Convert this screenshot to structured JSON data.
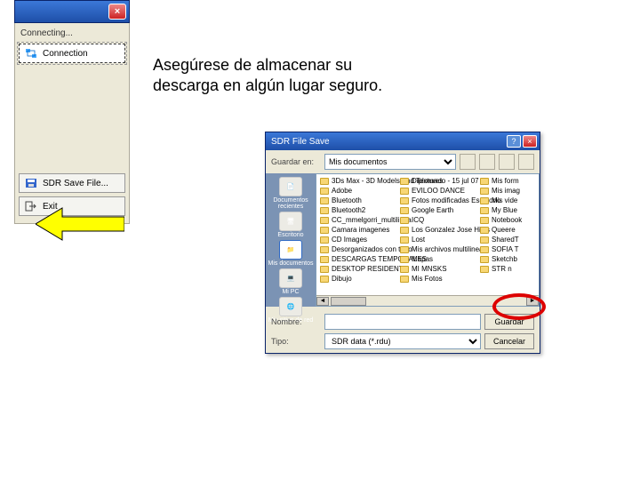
{
  "instruction": "Asegúrese de almacenar su descarga en algún lugar seguro.",
  "leftPanel": {
    "status": "Connecting...",
    "connectLabel": "Connection",
    "saveLabel": "SDR Save File...",
    "exitLabel": "Exit"
  },
  "saveDialog": {
    "title": "SDR File Save",
    "saveInLabel": "Guardar en:",
    "saveInValue": "Mis documentos",
    "sidebar": {
      "recent": "Documentos recientes",
      "desktop": "Escritorio",
      "mydocs": "Mis documentos",
      "mypc": "Mi PC",
      "network": "Mis sitios de red"
    },
    "cols": [
      [
        "3Ds Max - 3D Models And Textures",
        "Adobe",
        "Bluetooth",
        "Bluetooth2",
        "CC_mmelgorri_multilinea",
        "Camara imagenes",
        "CD Images",
        "Desorganizados con todo",
        "DESCARGAS TEMPORALES",
        "DESKTOP RESIDENT",
        "Dibujo"
      ],
      [
        "Diplomado - 15 jul 07",
        "EVILOO DANCE",
        "Fotos modificadas Escritorio",
        "Google Earth",
        "ICQ",
        "Los Gonzalez Jose Hilos",
        "Lost",
        "Mis archivos multilineas",
        "Mapas",
        "MI MNSKS",
        "Mis Fotos"
      ],
      [
        "Mis form",
        "Mis imag",
        "Mis vide",
        "My Blue",
        "Notebook",
        "Queere",
        "SharedT",
        "SOFIA T",
        "Sketchb",
        "STR n"
      ]
    ],
    "fileNameLabel": "Nombre:",
    "fileNameValue": "",
    "fileTypeLabel": "Tipo:",
    "fileTypeValue": "SDR data (*.rdu)",
    "saveBtn": "Guardar",
    "cancelBtn": "Cancelar"
  }
}
